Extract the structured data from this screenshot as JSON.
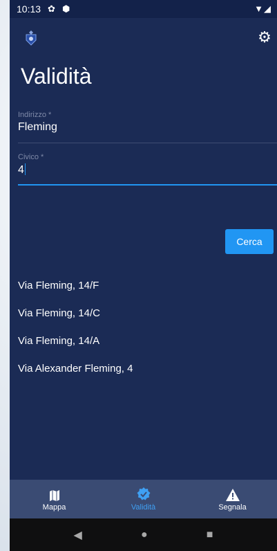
{
  "status_bar": {
    "time": "10:13",
    "icons_left": [
      "gear-icon",
      "shield-icon"
    ],
    "icons_right": "▼◢"
  },
  "header": {
    "title": "Validità"
  },
  "form": {
    "address": {
      "label": "Indirizzo *",
      "value": "Fleming"
    },
    "civic": {
      "label": "Civico *",
      "value": "4"
    }
  },
  "search_button": {
    "label": "Cerca"
  },
  "results": [
    "Via Fleming, 14/F",
    "Via Fleming, 14/C",
    "Via Fleming, 14/A",
    "Via Alexander Fleming, 4"
  ],
  "bottom_nav": [
    {
      "label": "Mappa",
      "icon": "map-icon"
    },
    {
      "label": "Validità",
      "icon": "verified-icon",
      "active": true
    },
    {
      "label": "Segnala",
      "icon": "warning-icon"
    }
  ],
  "colors": {
    "background": "#1b2b55",
    "accent": "#2196f3",
    "nav": "#3a4b73"
  }
}
